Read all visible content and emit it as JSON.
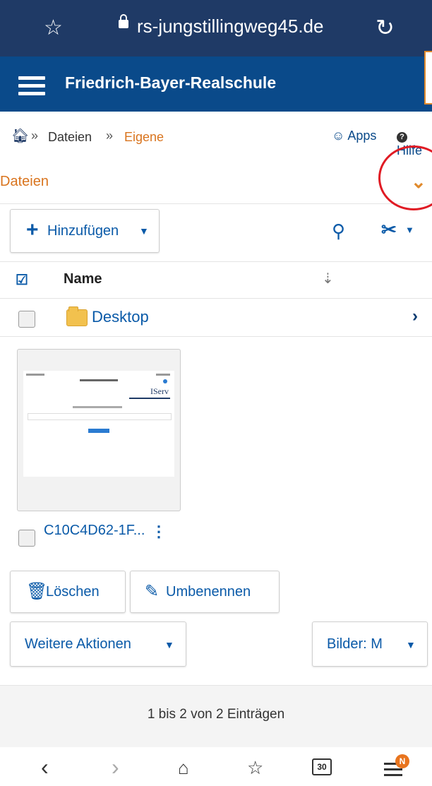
{
  "browser": {
    "url": "rs-jungstillingweg45.de",
    "bookmark_icon": "star-outline-icon",
    "reload_icon": "reload-icon"
  },
  "app": {
    "title": "Friedrich-Bayer-Realschule"
  },
  "breadcrumb": {
    "home_icon": "home-icon",
    "sep": "»",
    "items": [
      "Dateien",
      "Eigene"
    ],
    "apps": "Apps",
    "help": "Hilfe"
  },
  "section": {
    "label": "Dateien"
  },
  "toolbar": {
    "add_label": "Hinzufügen"
  },
  "table": {
    "col_name": "Name",
    "rows": [
      {
        "name": "Desktop",
        "type": "folder"
      }
    ],
    "images": [
      {
        "name": "C10C4D62-1F...",
        "thumb_logo": "IServ"
      }
    ]
  },
  "actions": {
    "delete": "Löschen",
    "rename": "Umbenennen",
    "more": "Weitere Aktionen",
    "view": "Bilder: M"
  },
  "footer": {
    "count": "1 bis 2 von 2 Einträgen"
  },
  "navbar": {
    "tabs_count": "30",
    "badge": "N"
  },
  "colors": {
    "header_bg": "#0a4a8a",
    "urlbar_bg": "#1f3a66",
    "accent_orange": "#d9741e",
    "link_blue": "#0a5aa8"
  }
}
